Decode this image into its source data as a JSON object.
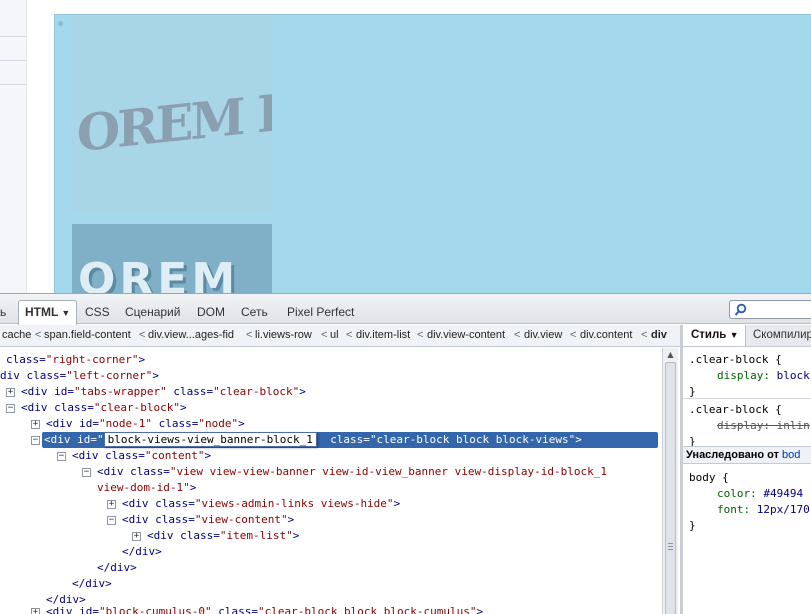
{
  "page": {
    "lorem_top": "OREM IPSU",
    "lorem_bottom": "OREM"
  },
  "firebug": {
    "tabs": {
      "cut_label": "ь",
      "html_label": "HTML",
      "css_label": "CSS",
      "script_label": "Сценарий",
      "dom_label": "DOM",
      "net_label": "Сеть",
      "pixel_label": "Pixel Perfect"
    },
    "breadcrumbs": [
      "cache",
      "span.field-content",
      "div.view...ages-fid",
      "li.views-row",
      "ul",
      "div.item-list",
      "div.view-content",
      "div.view",
      "div.content",
      "div"
    ],
    "side_tabs": {
      "style_label": "Стиль",
      "computed_label": "Скомпилир"
    },
    "tree": {
      "l0": {
        "attr": "class=",
        "val": "\"right-corner\"",
        "tail": ">"
      },
      "l1": {
        "tag": "div",
        "attr": "class=",
        "val": "\"left-corner\"",
        "tail": ">"
      },
      "l2": {
        "tag": "<div",
        "a1": "id=",
        "v1": "\"tabs-wrapper\"",
        "a2": "class=",
        "v2": "\"clear-block\"",
        "tail": ">"
      },
      "l3": {
        "tag": "<div",
        "a1": "class=",
        "v1": "\"clear-block\"",
        "tail": ">"
      },
      "l4": {
        "tag": "<div",
        "a1": "id=",
        "v1": "\"node-1\"",
        "a2": "class=",
        "v2": "\"node\"",
        "tail": ">"
      },
      "l5": {
        "tag": "<div",
        "a1": "id=",
        "q": "\"",
        "edit": "block-views-view_banner-block_1",
        "a2": "class=",
        "v2": "\"clear-block block block-views\"",
        "tail": ">"
      },
      "l6": {
        "tag": "<div",
        "a1": "class=",
        "v1": "\"content\"",
        "tail": ">"
      },
      "l7": {
        "tag": "<div",
        "a1": "class=",
        "v1": "\"view view-view-banner view-id-view_banner view-display-id-block_1"
      },
      "l8": {
        "v1": "view-dom-id-1\"",
        "tail": ">"
      },
      "l9": {
        "tag": "<div",
        "a1": "class=",
        "v1": "\"views-admin-links views-hide\"",
        "tail": ">"
      },
      "l10": {
        "tag": "<div",
        "a1": "class=",
        "v1": "\"view-content\"",
        "tail": ">"
      },
      "l11": {
        "tag": "<div",
        "a1": "class=",
        "v1": "\"item-list\"",
        "tail": ">"
      },
      "l12": {
        "tag": "</div>"
      },
      "l13": {
        "tag": "</div>"
      },
      "l14": {
        "tag": "</div>"
      },
      "l15": {
        "tag": "</div>"
      },
      "l16": {
        "tag": "</div>"
      },
      "l17": {
        "tag": "<div",
        "a1": "id=",
        "v1": "\"block-cumulus-0\"",
        "a2": "class=",
        "v2": "\"clear-block block block-cumulus\"",
        "tail": ">"
      }
    },
    "styles": {
      "r1_selector": ".clear-block {",
      "r1_prop": "display:",
      "r1_val": "block",
      "close": "}",
      "r2_selector": ".clear-block {",
      "r2_struck": "display: inlin",
      "inherit_label": "Унаследовано от",
      "inherit_link": "bod",
      "r3_selector": "body {",
      "r3_prop1": "color:",
      "r3_val1": "#49494",
      "r3_prop2": "font:",
      "r3_val2": "12px/170"
    }
  },
  "colors": {
    "highlight": "#a4d8ec",
    "selected_row": "#3366aa",
    "attr_value": "#8b0000",
    "tag": "#000080"
  }
}
